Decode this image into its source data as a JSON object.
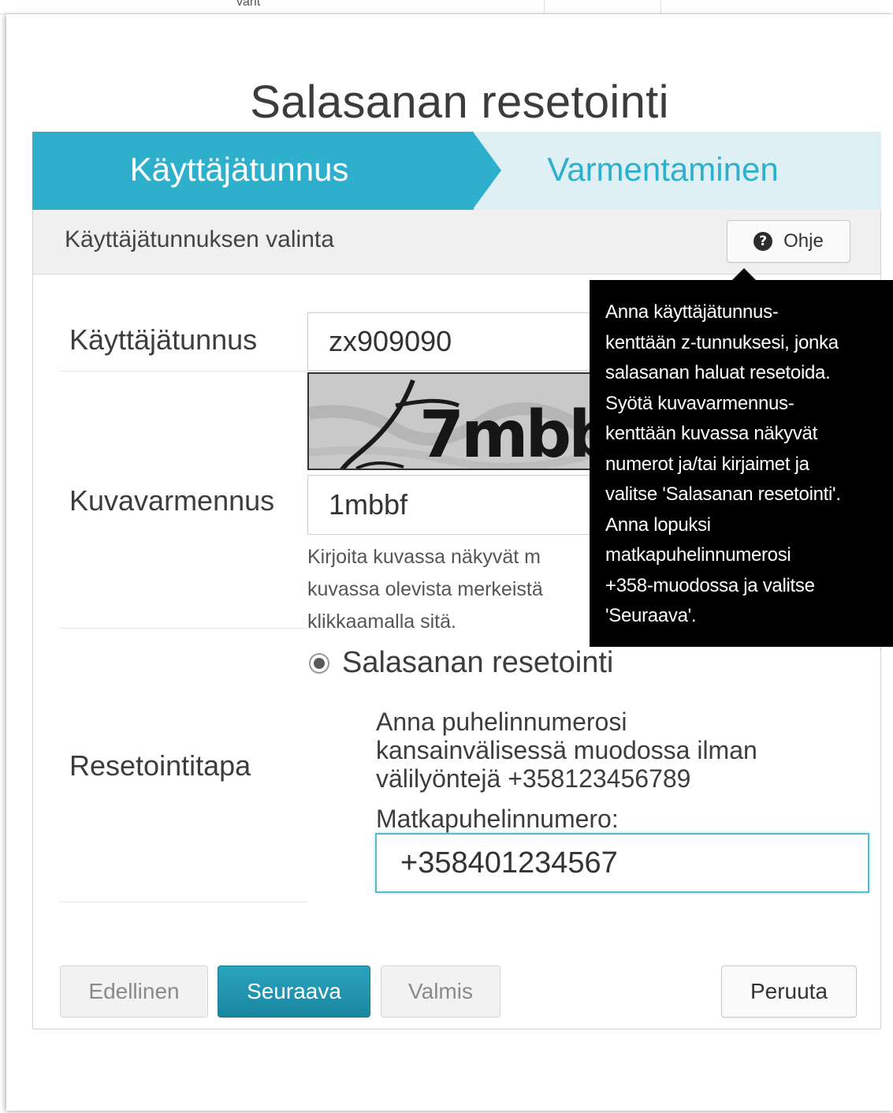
{
  "background": {
    "cut_text": "vant"
  },
  "dialog": {
    "title": "Salasanan resetointi",
    "steps": {
      "active": "Käyttäjätunnus",
      "next": "Varmentaminen"
    },
    "panel": {
      "heading": "Käyttäjätunnuksen valinta",
      "help_button": "Ohje",
      "username": {
        "label": "Käyttäjätunnus",
        "value": "zx909090"
      },
      "captcha": {
        "label": "Kuvavarmennus",
        "value": "1mbbf",
        "hint_lines": [
          "Kirjoita kuvassa näkyvät m",
          "kuvassa olevista merkeistä",
          "klikkaamalla sitä."
        ]
      },
      "reset_method": {
        "label": "Resetointitapa",
        "option": "Salasanan resetointi",
        "phone_info_lines": [
          "Anna puhelinnumerosi",
          "kansainvälisessä muodossa ilman",
          "välilyöntejä +358123456789"
        ],
        "phone_label": "Matkapuhelinnumero:",
        "phone_value": "+358401234567"
      }
    },
    "buttons": {
      "previous": "Edellinen",
      "next": "Seuraava",
      "finish": "Valmis",
      "cancel": "Peruuta"
    }
  },
  "tooltip": {
    "lines": [
      "Anna käyttäjätunnus-",
      "kenttään z-tunnuksesi, jonka",
      "salasanan haluat resetoida.",
      "Syötä kuvavarmennus-",
      "kenttään kuvassa näkyvät",
      "numerot ja/tai kirjaimet ja",
      "valitse 'Salasanan resetointi'.",
      "Anna lopuksi",
      "matkapuhelinnumerosi",
      "+358-muodossa ja valitse",
      "'Seuraava'."
    ]
  },
  "colors": {
    "accent": "#2eb0cc",
    "step_inactive_bg": "#dff0f5",
    "primary_button": "#1f93ae",
    "tooltip_bg": "#000000"
  }
}
